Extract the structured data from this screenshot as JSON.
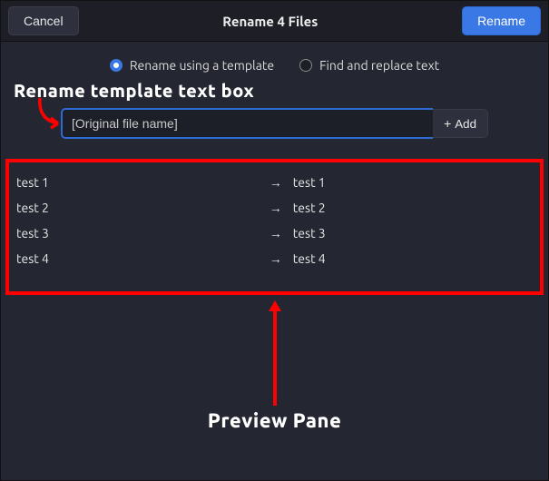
{
  "header": {
    "cancel": "Cancel",
    "title": "Rename 4 Files",
    "confirm": "Rename"
  },
  "mode": {
    "template_label": "Rename using a template",
    "find_replace_label": "Find and replace text"
  },
  "annotations": {
    "template_box": "Rename template text box",
    "preview_pane": "Preview Pane"
  },
  "template": {
    "value": "[Original file name]",
    "add_label": "Add"
  },
  "preview": [
    {
      "old": "test 1",
      "new": "test 1"
    },
    {
      "old": "test 2",
      "new": "test 2"
    },
    {
      "old": "test 3",
      "new": "test 3"
    },
    {
      "old": "test 4",
      "new": "test 4"
    }
  ],
  "glyphs": {
    "arrow_right": "→",
    "plus": "+"
  }
}
